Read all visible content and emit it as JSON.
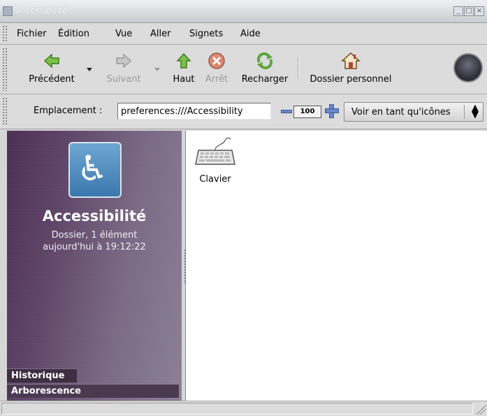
{
  "window": {
    "title": "Accessibilité"
  },
  "menu": {
    "file": "Fichier",
    "edit": "Édition",
    "view": "Vue",
    "go": "Aller",
    "bookmarks": "Signets",
    "help": "Aide"
  },
  "toolbar": {
    "back": "Précédent",
    "forward": "Suivant",
    "up": "Haut",
    "stop": "Arrêt",
    "reload": "Recharger",
    "home": "Dossier personnel"
  },
  "location": {
    "label": "Emplacement :",
    "value": "preferences:///Accessibility",
    "zoom": "100",
    "view_as": "Voir en tant qu'icônes"
  },
  "sidebar": {
    "title": "Accessibilité",
    "info_line1": "Dossier, 1 élément",
    "info_line2": "aujourd'hui à 19:12:22",
    "tabs": [
      "Historique",
      "Arborescence"
    ]
  },
  "files": [
    {
      "name": "Clavier",
      "icon": "keyboard-icon"
    }
  ],
  "colors": {
    "sidebar_bg": "#5f4669",
    "accessibility_icon_bg": "#3b78ae"
  }
}
